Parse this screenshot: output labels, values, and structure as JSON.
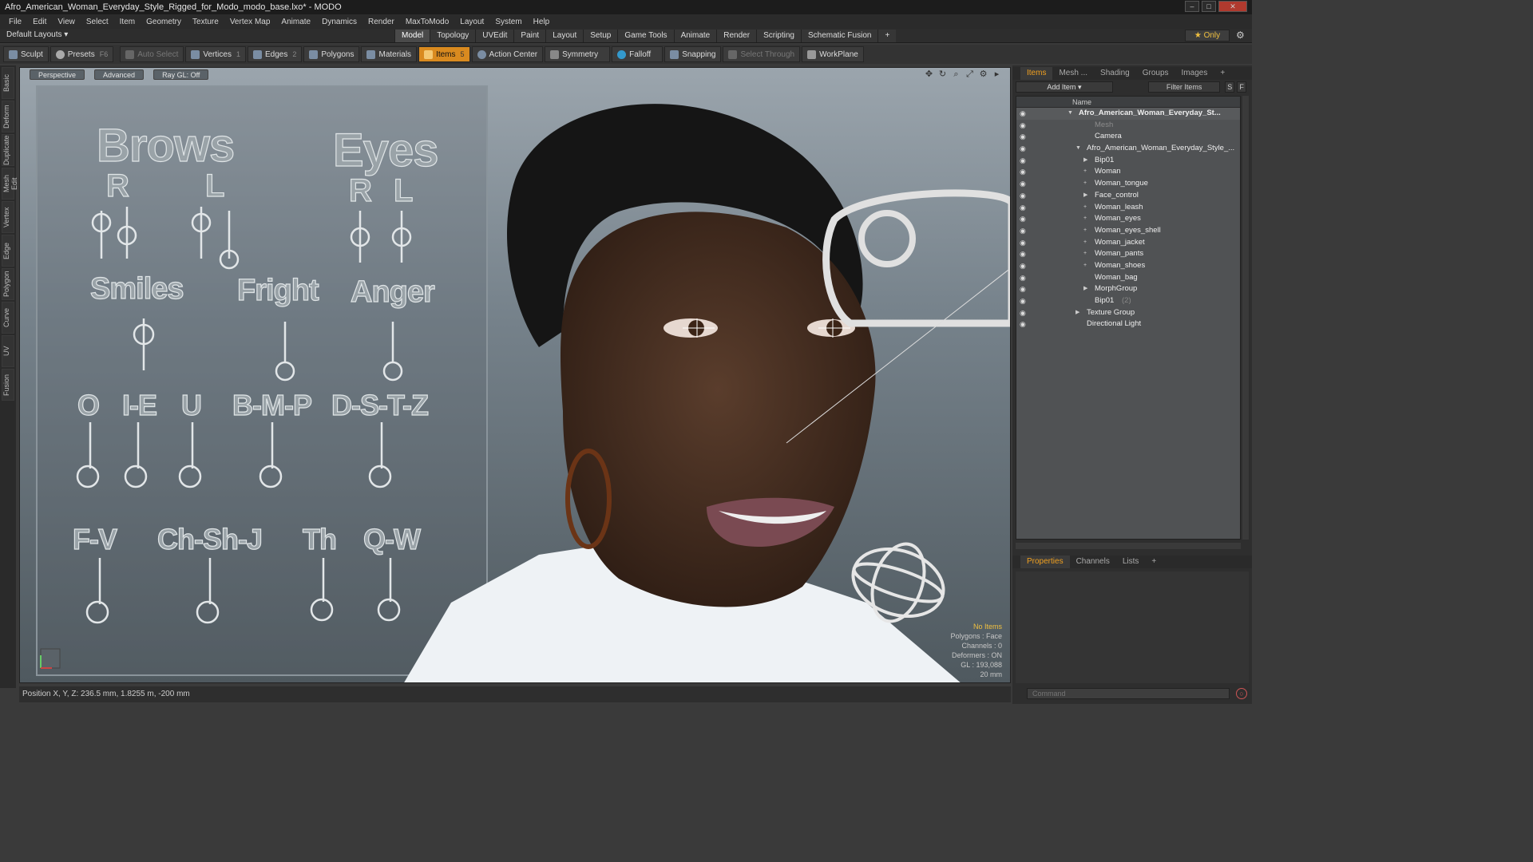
{
  "window": {
    "title": "Afro_American_Woman_Everyday_Style_Rigged_for_Modo_modo_base.lxo* - MODO"
  },
  "menu": [
    "File",
    "Edit",
    "View",
    "Select",
    "Item",
    "Geometry",
    "Texture",
    "Vertex Map",
    "Animate",
    "Dynamics",
    "Render",
    "MaxToModo",
    "Layout",
    "System",
    "Help"
  ],
  "layout": {
    "default_layouts": "Default Layouts ▾",
    "tabs": [
      "Model",
      "Topology",
      "UVEdit",
      "Paint",
      "Layout",
      "Setup",
      "Game Tools",
      "Animate",
      "Render",
      "Scripting",
      "Schematic Fusion",
      "+"
    ],
    "active_tab": "Model",
    "only_label": "★  Only"
  },
  "toolbar": {
    "sculpt": "Sculpt",
    "presets": "Presets",
    "presets_key": "F6",
    "auto_select": "Auto Select",
    "vertices": "Vertices",
    "vertices_count": "1",
    "edges": "Edges",
    "edges_count": "2",
    "polygons": "Polygons",
    "materials": "Materials",
    "items": "Items",
    "items_count": "5",
    "action_center": "Action Center",
    "symmetry": "Symmetry",
    "falloff": "Falloff",
    "snapping": "Snapping",
    "select_through": "Select Through",
    "workplane": "WorkPlane"
  },
  "left_tabs": [
    "Basic",
    "Deform",
    "Duplicate",
    "Mesh Edit",
    "Vertex",
    "Edge",
    "Polygon",
    "Curve",
    "UV",
    "Fusion"
  ],
  "viewport": {
    "view_mode": "Perspective",
    "shading": "Advanced",
    "raygl": "Ray GL: Off",
    "panel_labels": {
      "brows": "Brows",
      "eyes": "Eyes",
      "brow_r": "R",
      "brow_l": "L",
      "eye_r": "R",
      "eye_l": "L",
      "smiles": "Smiles",
      "fright": "Fright",
      "anger": "Anger",
      "o": "O",
      "ie": "I-E",
      "u": "U",
      "bmp": "B-M-P",
      "dstz": "D-S-T-Z",
      "fv": "F-V",
      "chshj": "Ch-Sh-J",
      "th": "Th",
      "qw": "Q-W"
    },
    "stats": {
      "items": "No Items",
      "polygons": "Polygons : Face",
      "channels": "Channels : 0",
      "deformers": "Deformers : ON",
      "gl": "GL : 193,088",
      "scale": "20 mm"
    }
  },
  "status": {
    "position": "Position X, Y, Z:   236.5 mm, 1.8255 m, -200 mm"
  },
  "right_panel": {
    "tabs": [
      "Items",
      "Mesh ...",
      "Shading",
      "Groups",
      "Images",
      "+"
    ],
    "active_tab": "Items",
    "add_item": "Add Item",
    "filter_items": "Filter Items",
    "s_btn": "S",
    "f_btn": "F",
    "col_name": "Name",
    "tree": [
      {
        "label": "Afro_American_Woman_Everyday_St...",
        "indent": 0,
        "bold": true,
        "expander": "▼"
      },
      {
        "label": "Mesh",
        "indent": 2,
        "dim": true,
        "expander": ""
      },
      {
        "label": "Camera",
        "indent": 2,
        "expander": ""
      },
      {
        "label": "Afro_American_Woman_Everyday_Style_...",
        "indent": 1,
        "expander": "▼"
      },
      {
        "label": "Bip01",
        "indent": 2,
        "expander": "▶"
      },
      {
        "label": "Woman",
        "indent": 2,
        "expander": "+"
      },
      {
        "label": "Woman_tongue",
        "indent": 2,
        "expander": "+"
      },
      {
        "label": "Face_control",
        "indent": 2,
        "expander": "▶"
      },
      {
        "label": "Woman_leash",
        "indent": 2,
        "expander": "+"
      },
      {
        "label": "Woman_eyes",
        "indent": 2,
        "expander": "+"
      },
      {
        "label": "Woman_eyes_shell",
        "indent": 2,
        "expander": "+"
      },
      {
        "label": "Woman_jacket",
        "indent": 2,
        "expander": "+"
      },
      {
        "label": "Woman_pants",
        "indent": 2,
        "expander": "+"
      },
      {
        "label": "Woman_shoes",
        "indent": 2,
        "expander": "+"
      },
      {
        "label": "Woman_bag",
        "indent": 2,
        "expander": ""
      },
      {
        "label": "MorphGroup",
        "indent": 2,
        "expander": "▶"
      },
      {
        "label": "Bip01",
        "indent": 2,
        "expander": "",
        "tag": "(2)"
      },
      {
        "label": "Texture Group",
        "indent": 1,
        "expander": "▶"
      },
      {
        "label": "Directional Light",
        "indent": 1,
        "expander": ""
      }
    ],
    "bottom_tabs": [
      "Properties",
      "Channels",
      "Lists",
      "+"
    ],
    "bottom_active": "Properties",
    "command_placeholder": "Command"
  }
}
